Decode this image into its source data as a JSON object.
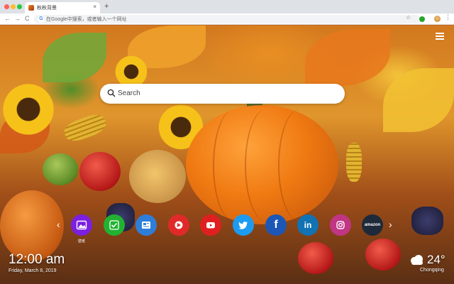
{
  "browser": {
    "tab_title": "秋秋背景",
    "tab_close": "×",
    "new_tab": "+",
    "back": "←",
    "forward": "→",
    "reload": "C",
    "omnibox_placeholder": "在Google中搜索，或者输入一个网址",
    "star": "☆",
    "menu": "⋮"
  },
  "page": {
    "search_placeholder": "Search",
    "shortcuts": [
      {
        "name": "wallpaper",
        "label": "壁纸",
        "color": "#7b1fe0",
        "icon": "image-icon"
      },
      {
        "name": "checklist",
        "label": "",
        "color": "#22b232",
        "icon": "check-icon"
      },
      {
        "name": "news",
        "label": "",
        "color": "#2e7ed9",
        "icon": "news-icon"
      },
      {
        "name": "game",
        "label": "",
        "color": "#e02a2a",
        "icon": "game-icon"
      },
      {
        "name": "youtube",
        "label": "",
        "color": "#e02020",
        "icon": "youtube-icon"
      },
      {
        "name": "twitter",
        "label": "",
        "color": "#1d9bf0",
        "icon": "twitter-icon"
      },
      {
        "name": "facebook",
        "label": "",
        "color": "#1c57b7",
        "icon": "facebook-icon"
      },
      {
        "name": "linkedin",
        "label": "",
        "color": "#1173b4",
        "icon": "linkedin-icon"
      },
      {
        "name": "instagram",
        "label": "",
        "color": "#c13584",
        "icon": "instagram-icon"
      },
      {
        "name": "amazon",
        "label": "",
        "color": "#1e2a3a",
        "icon": "amazon-icon"
      }
    ],
    "linkedin_text": "in",
    "facebook_text": "f",
    "amazon_text": "amazon",
    "prev_arrow": "‹",
    "next_arrow": "›",
    "time": "12:00 am",
    "date": "Friday, March 8, 2019",
    "temperature": "24°",
    "city": "Chongqing"
  }
}
